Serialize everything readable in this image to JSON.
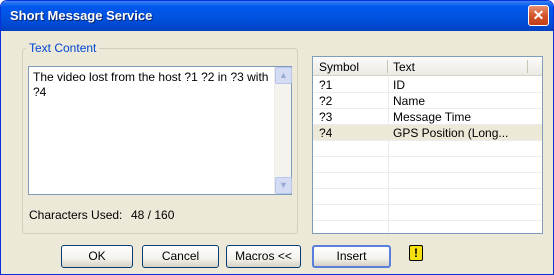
{
  "window": {
    "title": "Short Message Service",
    "close_glyph": "✕"
  },
  "text_content": {
    "legend": "Text Content",
    "value": "The video lost from the host ?1 ?2 in ?3 with ?4"
  },
  "characters": {
    "label": "Characters Used:",
    "value": "48 / 160"
  },
  "table": {
    "columns": [
      "Symbol",
      "Text"
    ],
    "rows": [
      {
        "symbol": "?1",
        "text": "ID"
      },
      {
        "symbol": "?2",
        "text": "Name"
      },
      {
        "symbol": "?3",
        "text": "Message Time"
      },
      {
        "symbol": "?4",
        "text": "GPS Position (Long..."
      }
    ],
    "selected_index": 3
  },
  "buttons": {
    "ok": "OK",
    "cancel": "Cancel",
    "macros": "Macros <<",
    "insert": "Insert"
  },
  "icons": {
    "warning": "!",
    "scroll_up": "▲",
    "scroll_down": "▼"
  },
  "colors": {
    "titlebar": "#0054e3",
    "legend": "#0046d5",
    "close": "#d4542c",
    "warning": "#f7e010"
  }
}
